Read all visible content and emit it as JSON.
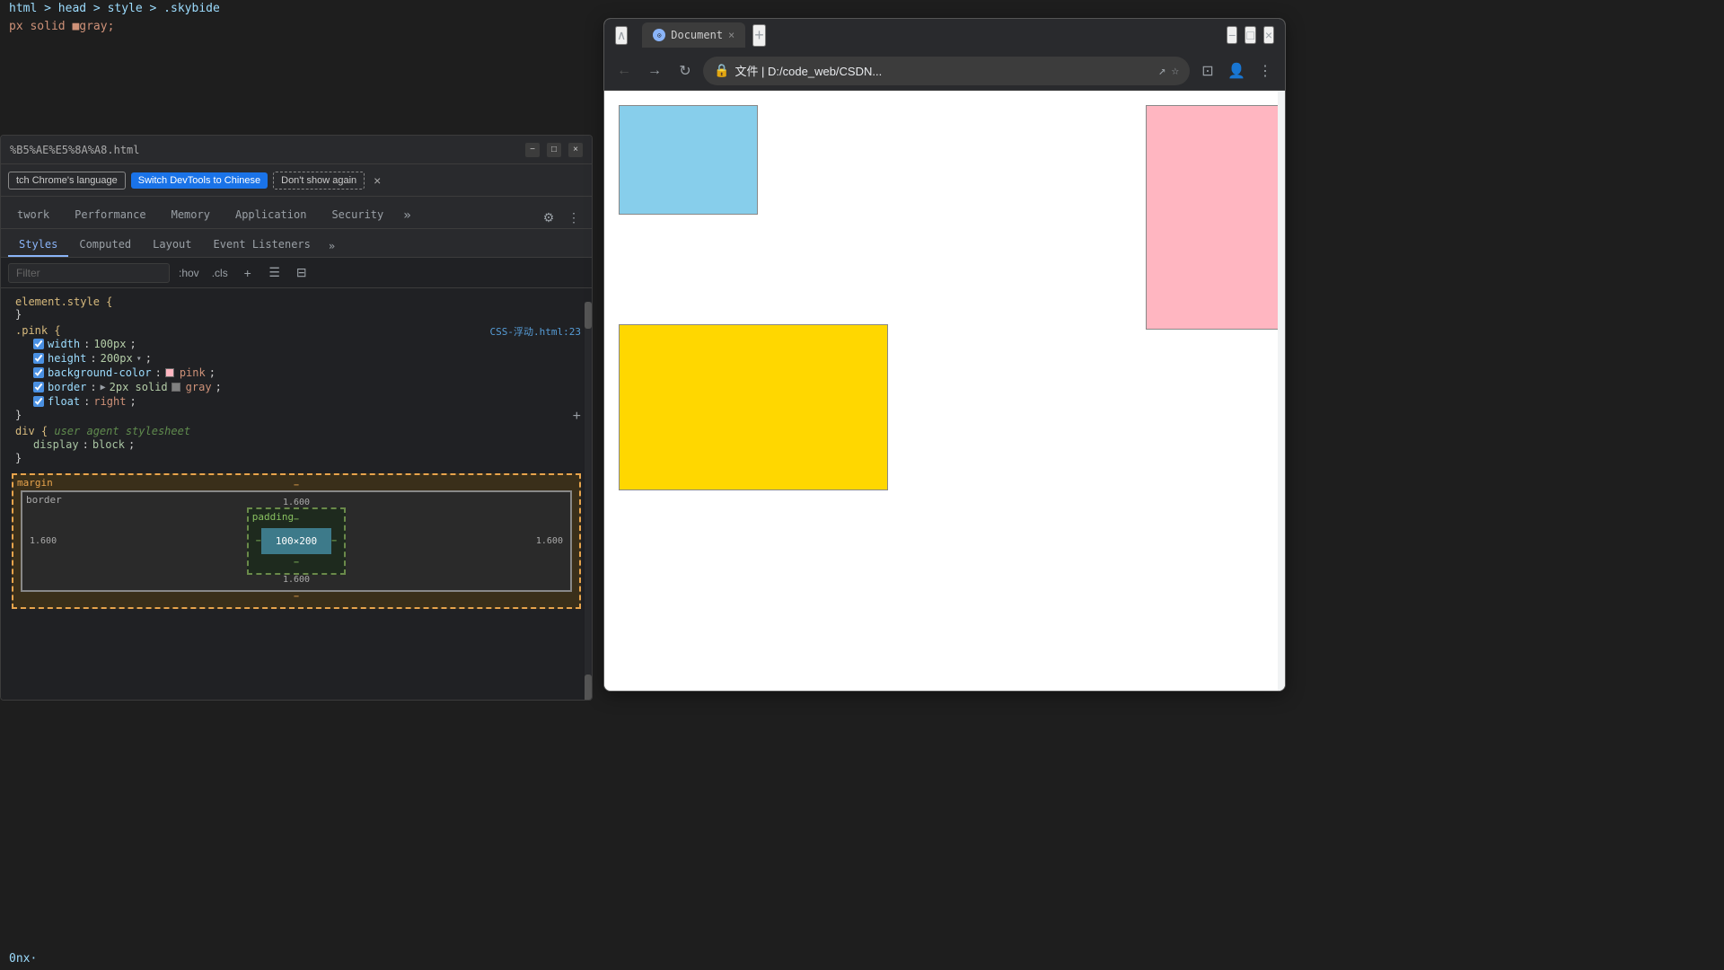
{
  "editor": {
    "breadcrumb": "html > head > style > .skybide",
    "code_line": "px solid ■gray;"
  },
  "devtools": {
    "title_bar": {
      "url": "%B5%AE%E5%8A%A8.html",
      "minimize": "−",
      "maximize": "□",
      "close": "×"
    },
    "language_bar": {
      "switch_language": "tch Chrome's language",
      "switch_devtools": "Switch DevTools to Chinese",
      "dont_show": "Don't show again",
      "close": "×"
    },
    "tabs": [
      {
        "label": "twork",
        "active": false
      },
      {
        "label": "Performance",
        "active": false
      },
      {
        "label": "Memory",
        "active": false
      },
      {
        "label": "Application",
        "active": false
      },
      {
        "label": "Security",
        "active": false
      },
      {
        "label": "»",
        "active": false
      }
    ],
    "tab_icons": {
      "settings": "⚙",
      "more": "⋮"
    },
    "styles_tabs": [
      {
        "label": "Styles",
        "active": true
      },
      {
        "label": "Computed",
        "active": false
      },
      {
        "label": "Layout",
        "active": false
      },
      {
        "label": "Event Listeners",
        "active": false
      },
      {
        "label": "»",
        "active": false
      }
    ],
    "filter_placeholder": "Filter",
    "filter_hov": ":hov",
    "filter_cls": ".cls",
    "filter_plus": "+",
    "css_rules": {
      "element_style": {
        "selector": "element.style {",
        "close": "}"
      },
      "pink_rule": {
        "selector": ".pink {",
        "source": "CSS-浮动.html:23",
        "properties": [
          {
            "name": "width",
            "value": "100px",
            "checked": true
          },
          {
            "name": "height",
            "value": "200px",
            "checked": true,
            "has_expand": true
          },
          {
            "name": "background-color",
            "value": "pink",
            "checked": true,
            "has_color": true,
            "color": "#ffb6c1"
          },
          {
            "name": "border",
            "value": "2px solid ■ gray",
            "checked": true,
            "has_expand": true
          },
          {
            "name": "float",
            "value": "right",
            "checked": true
          }
        ],
        "close": "}"
      },
      "div_rule": {
        "selector": "div {",
        "comment": "user agent stylesheet",
        "properties": [
          {
            "name": "display",
            "value": "block"
          }
        ],
        "close": "}"
      }
    },
    "box_model": {
      "margin_label": "margin",
      "border_label": "border",
      "padding_label": "padding",
      "content_size": "100×200",
      "margin_top": "−",
      "margin_right": "−",
      "margin_bottom": "−",
      "margin_left": "−",
      "border_val": "1.600",
      "padding_top": "−",
      "padding_bottom": "−",
      "padding_left": "−",
      "padding_right": "−"
    }
  },
  "browser": {
    "tab_label": "Document",
    "new_tab": "+",
    "window_btns": {
      "minimize": "−",
      "maximize": "□",
      "close": "×",
      "scroll_up": "∧"
    },
    "toolbar": {
      "back": "←",
      "forward": "→",
      "reload": "↻",
      "address_icon": "🔒",
      "address_text": "文件 | D:/code_web/CSDN...",
      "share": "↗",
      "star": "☆",
      "profile": "👤",
      "more": "⋮"
    },
    "boxes": {
      "blue": {
        "color": "#87ceeb",
        "label": "blue box"
      },
      "pink": {
        "color": "#ffb6c1",
        "label": "pink box"
      },
      "yellow": {
        "color": "#ffd700",
        "label": "yellow box"
      }
    }
  },
  "bottom_code": {
    "line": "0nx·"
  }
}
